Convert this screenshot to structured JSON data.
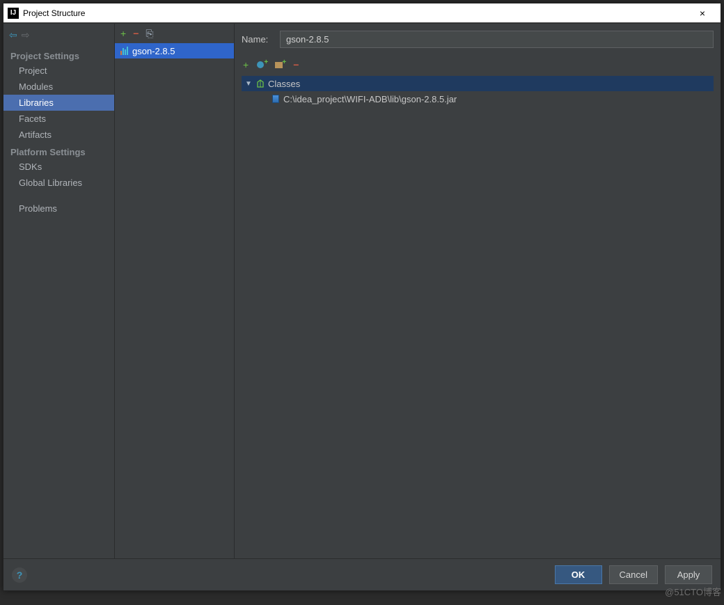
{
  "window": {
    "title": "Project Structure",
    "close_label": "×"
  },
  "sidebar": {
    "back_icon": "⇦",
    "forward_icon": "⇨",
    "heading_project": "Project Settings",
    "heading_platform": "Platform Settings",
    "items_project": [
      {
        "label": "Project"
      },
      {
        "label": "Modules"
      },
      {
        "label": "Libraries",
        "selected": true
      },
      {
        "label": "Facets"
      },
      {
        "label": "Artifacts"
      }
    ],
    "items_platform": [
      {
        "label": "SDKs"
      },
      {
        "label": "Global Libraries"
      }
    ],
    "item_problems": "Problems"
  },
  "liblist": {
    "add_icon": "+",
    "remove_icon": "−",
    "copy_icon": "⎘",
    "items": [
      {
        "label": "gson-2.8.5",
        "selected": true
      }
    ]
  },
  "main": {
    "name_label": "Name:",
    "name_value": "gson-2.8.5",
    "toolbar": {
      "add_icon": "+",
      "remove_icon": "−"
    },
    "tree": {
      "expander": "▼",
      "classes_label": "Classes",
      "classes_children": [
        {
          "path": "C:\\idea_project\\WIFI-ADB\\lib\\gson-2.8.5.jar"
        }
      ]
    }
  },
  "footer": {
    "help_icon": "?",
    "ok_label": "OK",
    "cancel_label": "Cancel",
    "apply_label": "Apply"
  },
  "watermark": "@51CTO博客"
}
